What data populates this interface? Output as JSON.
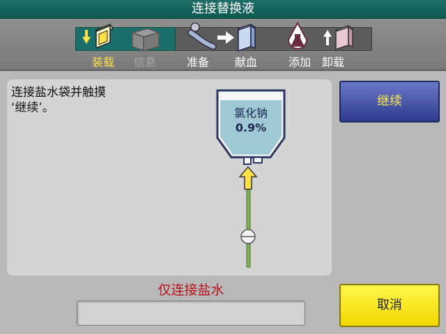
{
  "window": {
    "title": "连接替换液"
  },
  "workflow": {
    "steps": [
      {
        "label": "装载",
        "state": "active",
        "icon": "load-icon"
      },
      {
        "label": "信息",
        "state": "inactive",
        "icon": "info-folder-icon"
      },
      {
        "label": "准备",
        "state": "normal",
        "icon": "prepare-icon"
      },
      {
        "label": "献血",
        "state": "normal",
        "icon": "donate-icon"
      },
      {
        "label": "添加",
        "state": "normal",
        "icon": "add-solution-icon"
      },
      {
        "label": "卸载",
        "state": "normal",
        "icon": "unload-icon"
      }
    ]
  },
  "main": {
    "instruction": "连接盐水袋并触摸\n‘继续’。",
    "bag": {
      "name": "氯化钠",
      "concentration": "0.9%"
    },
    "warning": "仅连接盐水",
    "status_text": ""
  },
  "buttons": {
    "continue": "继续",
    "cancel": "取消"
  },
  "colors": {
    "title_bar": "#0d5a52",
    "active_step": "#ffe24a",
    "continue_button": "#2f3c8f",
    "cancel_button": "#f0d800",
    "warning_text": "#b8141a"
  }
}
